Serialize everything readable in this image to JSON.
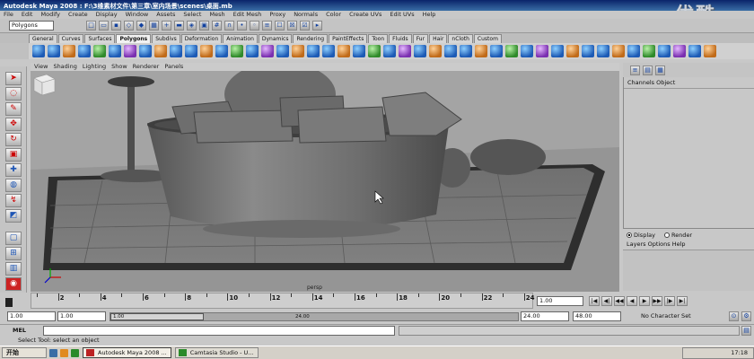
{
  "window": {
    "title": "Autodesk Maya 2008 : F:\\3维素材文件\\第三章\\室内场景\\scenes\\桌面.mb",
    "watermark": "优酷"
  },
  "menubar": [
    "File",
    "Edit",
    "Modify",
    "Create",
    "Display",
    "Window",
    "Assets",
    "Select",
    "Mesh",
    "Edit Mesh",
    "Proxy",
    "Normals",
    "Color",
    "Create UVs",
    "Edit UVs",
    "Help"
  ],
  "statusline": {
    "mode": "Polygons"
  },
  "shelf_tabs": [
    {
      "label": "General"
    },
    {
      "label": "Curves"
    },
    {
      "label": "Surfaces"
    },
    {
      "label": "Polygons",
      "active": true
    },
    {
      "label": "Subdivs"
    },
    {
      "label": "Deformation"
    },
    {
      "label": "Animation"
    },
    {
      "label": "Dynamics"
    },
    {
      "label": "Rendering"
    },
    {
      "label": "PaintEffects"
    },
    {
      "label": "Toon"
    },
    {
      "label": "Fluids"
    },
    {
      "label": "Fur"
    },
    {
      "label": "Hair"
    },
    {
      "label": "nCloth"
    },
    {
      "label": "Custom"
    }
  ],
  "panel_menu": [
    "View",
    "Shading",
    "Lighting",
    "Show",
    "Renderer",
    "Panels"
  ],
  "viewport": {
    "camera": "persp"
  },
  "channel_box": {
    "header": "Channels Object"
  },
  "layer_editor": {
    "display_label": "Display",
    "render_label": "Render",
    "menu": "Layers Options Help",
    "selected": "Display"
  },
  "time_slider": {
    "ticks": [
      "2",
      "4",
      "6",
      "8",
      "10",
      "12",
      "14",
      "16",
      "18",
      "20",
      "22",
      "24"
    ],
    "current_frame": "1.00"
  },
  "range_slider": {
    "start": "1.00",
    "start2": "1.00",
    "handle_start": "1.00",
    "handle_end": "24.00",
    "end": "24.00",
    "end2": "48.00",
    "character_set": "No Character Set"
  },
  "command_line": {
    "label": "MEL"
  },
  "help_line": "Select Tool: select an object",
  "taskbar": {
    "start": "开始",
    "items": [
      {
        "label": "Autodesk Maya 2008 ...",
        "active": true
      },
      {
        "label": "Camtasia Studio - U...",
        "active": false
      }
    ],
    "clock": "17:18"
  }
}
